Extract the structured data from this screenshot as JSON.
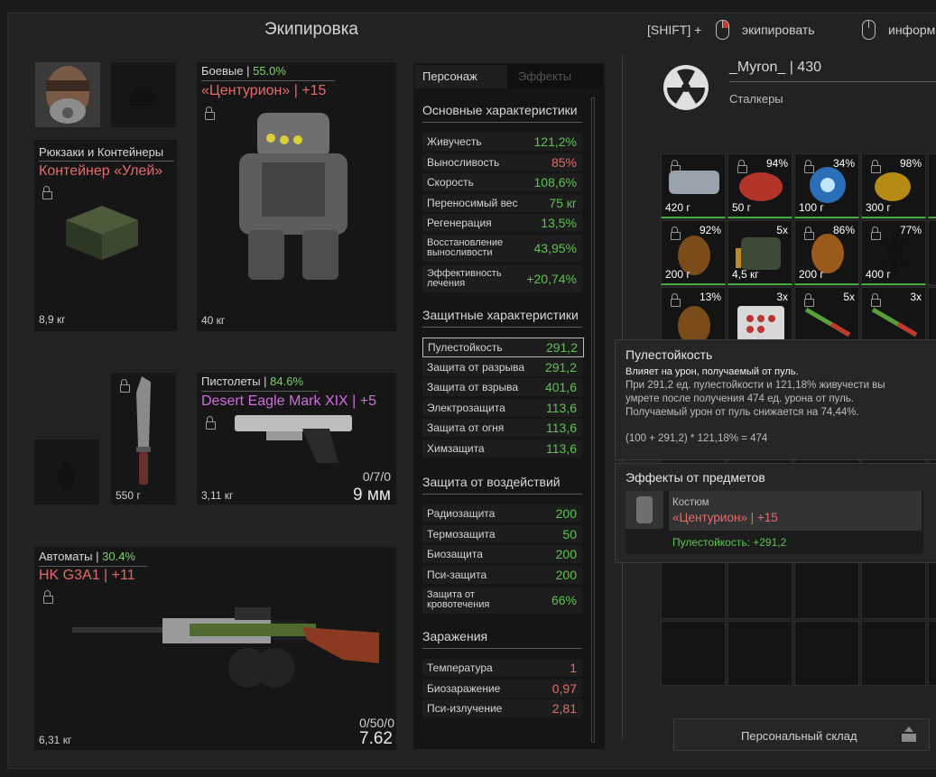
{
  "window_title": "Экипировка",
  "hints": {
    "shift_label": "[SHIFT] +",
    "equip_label": "экипировать",
    "info_label": "информ"
  },
  "character": {
    "name": "_Myron_ | 430",
    "faction": "Сталкеры"
  },
  "equipment": {
    "backpack": {
      "category": "Рюкзаки и Контейнеры",
      "name": "Контейнер «Улей»",
      "weight": "8,9 кг"
    },
    "armor": {
      "category": "Боевые |",
      "percent": "55.0%",
      "name": "«Центурион» | +15",
      "weight": "40 кг"
    },
    "knife": {
      "weight": "550 г"
    },
    "pistol": {
      "category": "Пистолеты |",
      "percent": "84.6%",
      "name": "Desert Eagle Mark XIX | +5",
      "weight": "3,11 кг",
      "ammo": "0/7/0",
      "caliber": "9 мм"
    },
    "rifle": {
      "category": "Автоматы |",
      "percent": "30.4%",
      "name": "HK G3A1 | +11",
      "weight": "6,31 кг",
      "ammo": "0/50/0",
      "caliber": "7.62"
    }
  },
  "tabs": {
    "character": "Персонаж",
    "effects": "Эффекты"
  },
  "stats": {
    "basic_title": "Основные характеристики",
    "basic": [
      {
        "label": "Живучесть",
        "value": "121,2%",
        "color": "green"
      },
      {
        "label": "Выносливость",
        "value": "85%",
        "color": "red"
      },
      {
        "label": "Скорость",
        "value": "108,6%",
        "color": "green"
      },
      {
        "label": "Переносимый вес",
        "value": "75 кг",
        "color": "green"
      },
      {
        "label": "Регенерация",
        "value": "13,5%",
        "color": "green"
      },
      {
        "label": "Восстановление выносливости",
        "value": "43,95%",
        "color": "green"
      },
      {
        "label": "Эффективность лечения",
        "value": "+20,74%",
        "color": "green"
      }
    ],
    "defense_title": "Защитные характеристики",
    "defense": [
      {
        "label": "Пулестойкость",
        "value": "291,2"
      },
      {
        "label": "Защита от разрыва",
        "value": "291,2"
      },
      {
        "label": "Защита от взрыва",
        "value": "401,6"
      },
      {
        "label": "Электрозащита",
        "value": "113,6"
      },
      {
        "label": "Защита от огня",
        "value": "113,6"
      },
      {
        "label": "Химзащита",
        "value": "113,6"
      }
    ],
    "impact_title": "Защита от воздействий",
    "impact": [
      {
        "label": "Радиозащита",
        "value": "200"
      },
      {
        "label": "Термозащита",
        "value": "50"
      },
      {
        "label": "Биозащита",
        "value": "200"
      },
      {
        "label": "Пси-защита",
        "value": "200"
      },
      {
        "label": "Защита от кровотечения",
        "value": "66%"
      }
    ],
    "infect_title": "Заражения",
    "infect": [
      {
        "label": "Температура",
        "value": "1"
      },
      {
        "label": "Биозаражение",
        "value": "0,97"
      },
      {
        "label": "Пси-излучение",
        "value": "2,81"
      }
    ]
  },
  "inventory": {
    "row1": [
      {
        "weight": "420 г",
        "pct": ""
      },
      {
        "weight": "50 г",
        "pct": "94%"
      },
      {
        "weight": "100 г",
        "pct": "34%"
      },
      {
        "weight": "300 г",
        "pct": "98%"
      }
    ],
    "row2": [
      {
        "weight": "200 г",
        "pct": "92%"
      },
      {
        "weight": "4,5 кг",
        "pct": "5x"
      },
      {
        "weight": "200 г",
        "pct": "86%"
      },
      {
        "weight": "400 г",
        "pct": "77%"
      }
    ],
    "row3": [
      {
        "weight": "",
        "pct": "13%"
      },
      {
        "weight": "",
        "pct": "3x"
      },
      {
        "weight": "",
        "pct": "5x"
      },
      {
        "weight": "",
        "pct": "3x"
      }
    ],
    "storage_button": "Персональный склад"
  },
  "tooltip": {
    "title": "Пулестойкость",
    "subtitle": "Влияет на урон, получаемый от пуль.",
    "line1": "При 291,2 ед. пулестойкости и 121,18% живучести вы",
    "line2": "умрете после получения 474 ед. урона от пуль.",
    "line3": "Получаемый урон от пуль снижается на 74,44%.",
    "formula": "(100 + 291,2) * 121,18% = 474",
    "effects_title": "Эффекты от предметов",
    "effect_item_type": "Костюм",
    "effect_item_name": "«Центурион» | +15",
    "effect_bonus": "Пулестойкость: +291,2"
  }
}
